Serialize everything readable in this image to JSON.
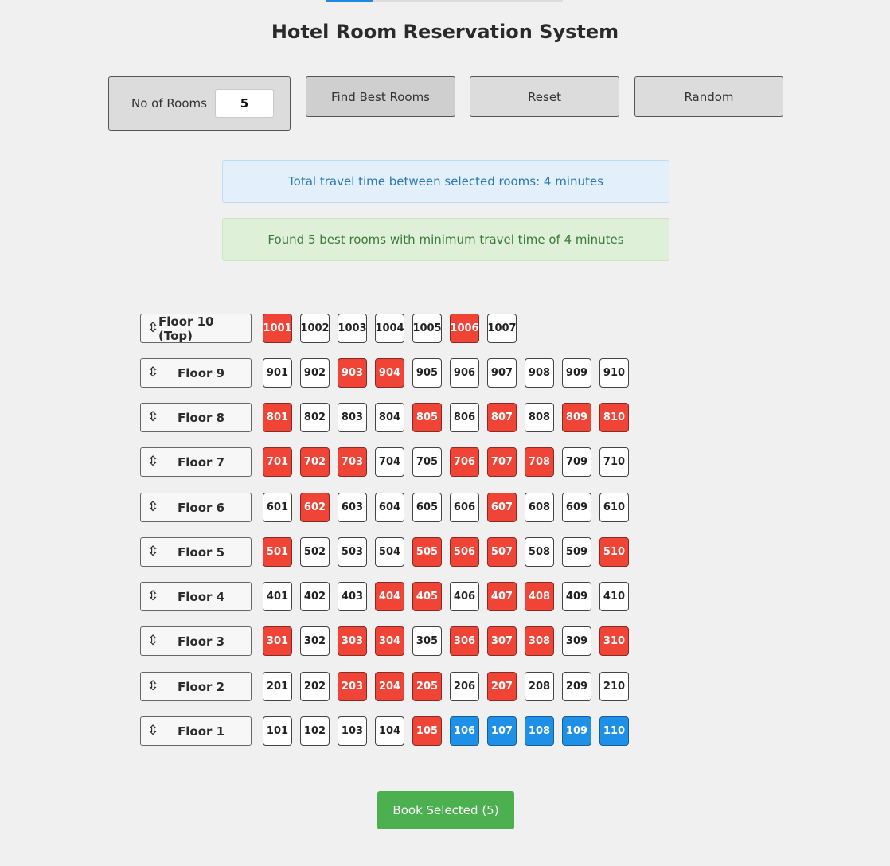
{
  "app": {
    "title": "Hotel Room Reservation System"
  },
  "controls": {
    "rooms_label": "No of Rooms",
    "rooms_value": "5",
    "find_label": "Find Best Rooms",
    "reset_label": "Reset",
    "random_label": "Random"
  },
  "messages": {
    "travel_time": "Total travel time between selected rooms: 4 minutes",
    "found": "Found 5 best rooms with minimum travel time of 4 minutes"
  },
  "icons": {
    "floor": "up-down-arrow-icon"
  },
  "colors": {
    "booked": "#f04437",
    "selected": "#1e90e8",
    "available": "#ffffff",
    "book_button": "#4caf50"
  },
  "floors": [
    {
      "label": "Floor 10 (Top)",
      "rooms": [
        {
          "number": "1001",
          "status": "booked"
        },
        {
          "number": "1002",
          "status": "available"
        },
        {
          "number": "1003",
          "status": "available"
        },
        {
          "number": "1004",
          "status": "available"
        },
        {
          "number": "1005",
          "status": "available"
        },
        {
          "number": "1006",
          "status": "booked"
        },
        {
          "number": "1007",
          "status": "available"
        }
      ]
    },
    {
      "label": "Floor 9",
      "rooms": [
        {
          "number": "901",
          "status": "available"
        },
        {
          "number": "902",
          "status": "available"
        },
        {
          "number": "903",
          "status": "booked"
        },
        {
          "number": "904",
          "status": "booked"
        },
        {
          "number": "905",
          "status": "available"
        },
        {
          "number": "906",
          "status": "available"
        },
        {
          "number": "907",
          "status": "available"
        },
        {
          "number": "908",
          "status": "available"
        },
        {
          "number": "909",
          "status": "available"
        },
        {
          "number": "910",
          "status": "available"
        }
      ]
    },
    {
      "label": "Floor 8",
      "rooms": [
        {
          "number": "801",
          "status": "booked"
        },
        {
          "number": "802",
          "status": "available"
        },
        {
          "number": "803",
          "status": "available"
        },
        {
          "number": "804",
          "status": "available"
        },
        {
          "number": "805",
          "status": "booked"
        },
        {
          "number": "806",
          "status": "available"
        },
        {
          "number": "807",
          "status": "booked"
        },
        {
          "number": "808",
          "status": "available"
        },
        {
          "number": "809",
          "status": "booked"
        },
        {
          "number": "810",
          "status": "booked"
        }
      ]
    },
    {
      "label": "Floor 7",
      "rooms": [
        {
          "number": "701",
          "status": "booked"
        },
        {
          "number": "702",
          "status": "booked"
        },
        {
          "number": "703",
          "status": "booked"
        },
        {
          "number": "704",
          "status": "available"
        },
        {
          "number": "705",
          "status": "available"
        },
        {
          "number": "706",
          "status": "booked"
        },
        {
          "number": "707",
          "status": "booked"
        },
        {
          "number": "708",
          "status": "booked"
        },
        {
          "number": "709",
          "status": "available"
        },
        {
          "number": "710",
          "status": "available"
        }
      ]
    },
    {
      "label": "Floor 6",
      "rooms": [
        {
          "number": "601",
          "status": "available"
        },
        {
          "number": "602",
          "status": "booked"
        },
        {
          "number": "603",
          "status": "available"
        },
        {
          "number": "604",
          "status": "available"
        },
        {
          "number": "605",
          "status": "available"
        },
        {
          "number": "606",
          "status": "available"
        },
        {
          "number": "607",
          "status": "booked"
        },
        {
          "number": "608",
          "status": "available"
        },
        {
          "number": "609",
          "status": "available"
        },
        {
          "number": "610",
          "status": "available"
        }
      ]
    },
    {
      "label": "Floor 5",
      "rooms": [
        {
          "number": "501",
          "status": "booked"
        },
        {
          "number": "502",
          "status": "available"
        },
        {
          "number": "503",
          "status": "available"
        },
        {
          "number": "504",
          "status": "available"
        },
        {
          "number": "505",
          "status": "booked"
        },
        {
          "number": "506",
          "status": "booked"
        },
        {
          "number": "507",
          "status": "booked"
        },
        {
          "number": "508",
          "status": "available"
        },
        {
          "number": "509",
          "status": "available"
        },
        {
          "number": "510",
          "status": "booked"
        }
      ]
    },
    {
      "label": "Floor 4",
      "rooms": [
        {
          "number": "401",
          "status": "available"
        },
        {
          "number": "402",
          "status": "available"
        },
        {
          "number": "403",
          "status": "available"
        },
        {
          "number": "404",
          "status": "booked"
        },
        {
          "number": "405",
          "status": "booked"
        },
        {
          "number": "406",
          "status": "available"
        },
        {
          "number": "407",
          "status": "booked"
        },
        {
          "number": "408",
          "status": "booked"
        },
        {
          "number": "409",
          "status": "available"
        },
        {
          "number": "410",
          "status": "available"
        }
      ]
    },
    {
      "label": "Floor 3",
      "rooms": [
        {
          "number": "301",
          "status": "booked"
        },
        {
          "number": "302",
          "status": "available"
        },
        {
          "number": "303",
          "status": "booked"
        },
        {
          "number": "304",
          "status": "booked"
        },
        {
          "number": "305",
          "status": "available"
        },
        {
          "number": "306",
          "status": "booked"
        },
        {
          "number": "307",
          "status": "booked"
        },
        {
          "number": "308",
          "status": "booked"
        },
        {
          "number": "309",
          "status": "available"
        },
        {
          "number": "310",
          "status": "booked"
        }
      ]
    },
    {
      "label": "Floor 2",
      "rooms": [
        {
          "number": "201",
          "status": "available"
        },
        {
          "number": "202",
          "status": "available"
        },
        {
          "number": "203",
          "status": "booked"
        },
        {
          "number": "204",
          "status": "booked"
        },
        {
          "number": "205",
          "status": "booked"
        },
        {
          "number": "206",
          "status": "available"
        },
        {
          "number": "207",
          "status": "booked"
        },
        {
          "number": "208",
          "status": "available"
        },
        {
          "number": "209",
          "status": "available"
        },
        {
          "number": "210",
          "status": "available"
        }
      ]
    },
    {
      "label": "Floor 1",
      "rooms": [
        {
          "number": "101",
          "status": "available"
        },
        {
          "number": "102",
          "status": "available"
        },
        {
          "number": "103",
          "status": "available"
        },
        {
          "number": "104",
          "status": "available"
        },
        {
          "number": "105",
          "status": "booked"
        },
        {
          "number": "106",
          "status": "selected"
        },
        {
          "number": "107",
          "status": "selected"
        },
        {
          "number": "108",
          "status": "selected"
        },
        {
          "number": "109",
          "status": "selected"
        },
        {
          "number": "110",
          "status": "selected"
        }
      ]
    }
  ],
  "book_button": {
    "label": "Book Selected (5)"
  }
}
